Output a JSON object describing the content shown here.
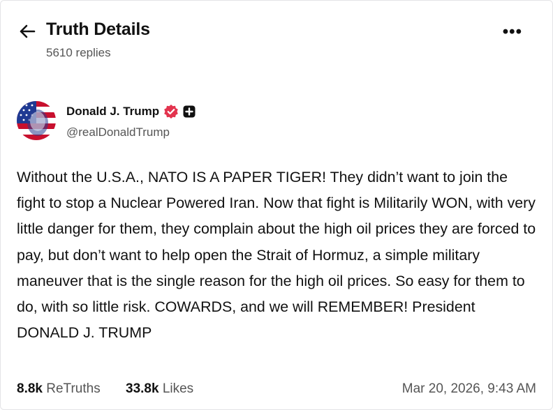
{
  "header": {
    "title": "Truth Details",
    "replies": "5610 replies",
    "more_label": "•••"
  },
  "author": {
    "name": "Donald J. Trump",
    "handle": "@realDonaldTrump",
    "verified_color": "#e3334e"
  },
  "post": {
    "text": "Without the U.S.A., NATO IS A PAPER TIGER! They didn’t want to join the fight to stop a Nuclear Powered Iran. Now that fight is Militarily WON, with very little danger for them, they complain about the high oil prices they are forced to pay, but don’t want to help open the Strait of Hormuz, a simple military maneuver that is the single reason for the high oil prices. So easy for them to do, with so little risk. COWARDS, and we will REMEMBER! President DONALD J. TRUMP"
  },
  "stats": {
    "retruths_count": "8.8k",
    "retruths_label": "ReTruths",
    "likes_count": "33.8k",
    "likes_label": "Likes",
    "timestamp": "Mar 20, 2026, 9:43 AM"
  }
}
